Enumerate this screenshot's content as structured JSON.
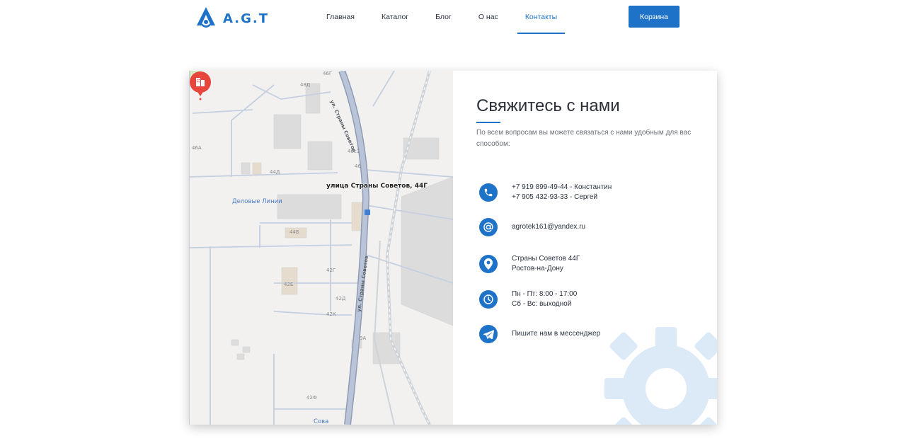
{
  "brand": {
    "name": "A.G.T"
  },
  "nav": {
    "items": [
      {
        "label": "Главная",
        "active": false
      },
      {
        "label": "Каталог",
        "active": false
      },
      {
        "label": "Блог",
        "active": false
      },
      {
        "label": "О нас",
        "active": false
      },
      {
        "label": "Контакты",
        "active": true
      }
    ],
    "cart_label": "Корзина"
  },
  "map": {
    "marker_label": "улица Страны Советов, 44Г",
    "street_name_top": "ул. Страны Советов",
    "street_name_bottom": "ул. Страны Советов",
    "poi": "Деловые Линии",
    "poi_bottom": "Сова",
    "building_labels": [
      "46Г",
      "48Д",
      "46А",
      "46с1",
      "46",
      "44Д",
      "44Б",
      "42Г",
      "42Е",
      "42Д",
      "42К",
      "9А",
      "42Ф"
    ]
  },
  "contact": {
    "title": "Свяжитесь с нами",
    "lead": "По всем вопросам вы можете связаться с нами удобным для вас способом:",
    "phone": {
      "icon": "phone-icon",
      "lines": [
        "+7 919 899-49-44 - Константин",
        "+7 905 432-93-33 - Сергей"
      ]
    },
    "email": {
      "icon": "at-icon",
      "lines": [
        "agrotek161@yandex.ru"
      ]
    },
    "address": {
      "icon": "location-pin-icon",
      "lines": [
        "Страны Советов 44Г",
        "Ростов-на-Дону"
      ]
    },
    "hours": {
      "icon": "clock-icon",
      "lines": [
        "Пн - Пт: 8:00 - 17:00",
        "Сб - Вс: выходной"
      ]
    },
    "messenger": {
      "icon": "telegram-icon",
      "lines": [
        "Пишите нам в мессенджер"
      ]
    }
  },
  "colors": {
    "accent": "#1e73c8",
    "gear": "#dce9f7",
    "map_bg": "#f2f1ef"
  }
}
